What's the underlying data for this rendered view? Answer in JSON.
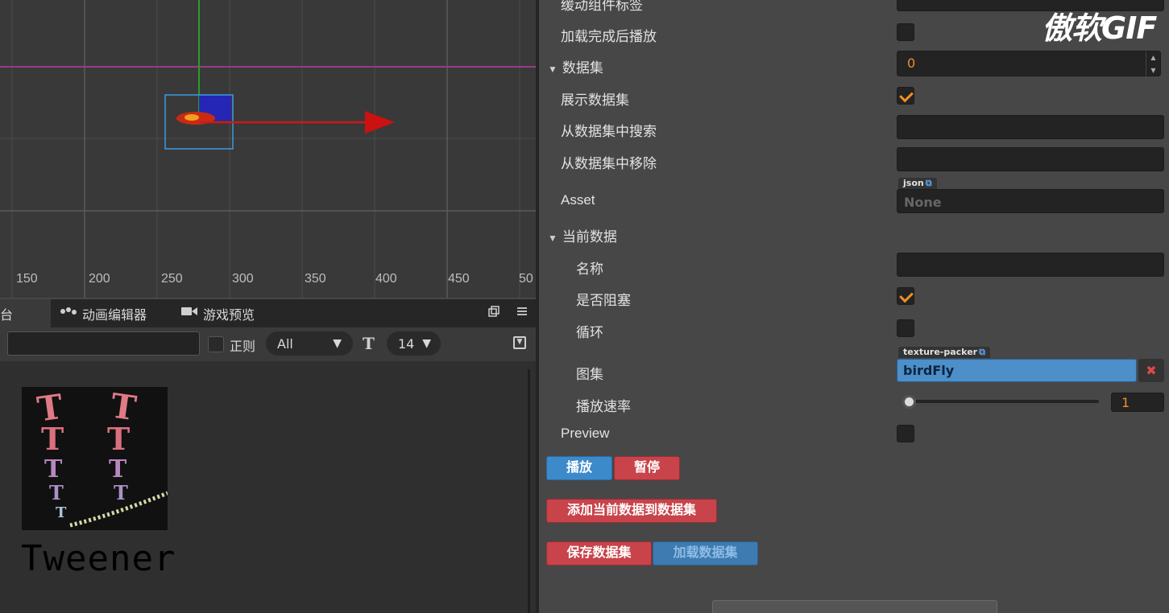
{
  "scene": {
    "ruler_ticks": [
      "150",
      "200",
      "250",
      "300",
      "350",
      "400",
      "450",
      "50"
    ]
  },
  "console": {
    "tabs": [
      {
        "label": "台",
        "icon": "console-icon"
      },
      {
        "label": "动画编辑器",
        "icon": "animation-icon"
      },
      {
        "label": "游戏预览",
        "icon": "camera-icon"
      }
    ],
    "regex_label": "正则",
    "level_select": "All",
    "font_size_select": "14",
    "thumbnail_caption": "Tweener"
  },
  "inspector": {
    "rows": {
      "easing_label": "缓动组件标签",
      "play_on_load": "加载完成后播放",
      "dataset": "数据集",
      "dataset_value": "0",
      "show_dataset": "展示数据集",
      "search_dataset": "从数据集中搜索",
      "remove_dataset": "从数据集中移除",
      "asset": "Asset",
      "asset_tag": "json",
      "asset_value": "None",
      "current_data": "当前数据",
      "name": "名称",
      "blocking": "是否阻塞",
      "loop": "循环",
      "atlas": "图集",
      "atlas_tag": "texture-packer",
      "atlas_value": "birdFly",
      "atlas_clear": "✖",
      "play_rate": "播放速率",
      "play_rate_value": "1",
      "preview": "Preview"
    },
    "buttons": {
      "play": "播放",
      "pause": "暂停",
      "add_current": "添加当前数据到数据集",
      "save_dataset": "保存数据集",
      "load_dataset": "加载数据集"
    },
    "checks": {
      "play_on_load": false,
      "show_dataset": true,
      "blocking": true,
      "loop": false,
      "preview": false
    }
  },
  "watermark": "傲软GIF"
}
